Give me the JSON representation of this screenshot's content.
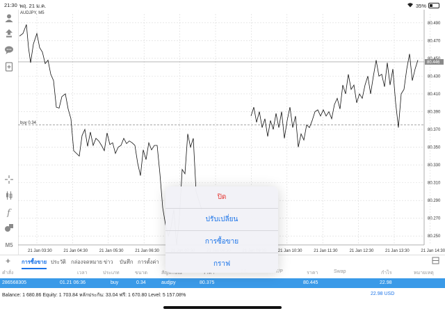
{
  "status": {
    "time": "21:30",
    "date": "พฤ. 21 ม.ค.",
    "battery": "35%"
  },
  "chart": {
    "symbol": "AUDJPY, M5",
    "buy_label": "buy 0.34",
    "price_ticks": [
      "80.490",
      "80.470",
      "80.450",
      "80.430",
      "80.410",
      "80.390",
      "80.370",
      "80.350",
      "80.330",
      "80.310",
      "80.290",
      "80.270",
      "80.250"
    ],
    "price_range": [
      80.24,
      80.5
    ],
    "current_price": "80.446",
    "current_price_value": 80.446,
    "buy_price_value": 80.375,
    "time_ticks": [
      "21 Jan 03:30",
      "21 Jan 04:30",
      "21 Jan 05:30",
      "21 Jan 06:30",
      "21 Jan 07:30",
      "21 Jan 08:30",
      "21 Jan 09:30",
      "21 Jan 10:30",
      "21 Jan 11:30",
      "21 Jan 12:30",
      "21 Jan 13:30",
      "21 Jan 14:30"
    ],
    "line_color": "#111111",
    "grid_color": "#d9d9d9",
    "current_price_color": "#8a8a8a"
  },
  "toolbar": {
    "icons": [
      "person-icon",
      "upload-arrows-icon",
      "chat-icon",
      "add-document-icon",
      "crosshair-icon",
      "candlestick-icon",
      "function-icon",
      "objects-icon",
      "timeframe-icon"
    ],
    "timeframe": "M5"
  },
  "tabs": [
    "การซื้อขาย",
    "ประวัติ",
    "กล่องจดหมาย",
    "ข่าว",
    "บันทึก",
    "การตั้งค่า"
  ],
  "table": {
    "headers": [
      "คำสั่ง",
      "เวลา",
      "ประเภท",
      "ขนาด",
      "สัญลักษณ์",
      "ราคา",
      "S/L",
      "T/P",
      "ราคา",
      "Swap",
      "กำไร",
      "หมายเหตุ"
    ],
    "row": [
      "286568305",
      "01.21 06:36",
      "buy",
      "0.34",
      "audjpy",
      "80.375",
      "",
      "",
      "80.445",
      "",
      "22.98",
      ""
    ]
  },
  "balance": {
    "text": "Balance: 1 680.86 Equity: 1 703.84 หลักประกัน: 33.04 ฟรี: 1 670.80 Level: 5 157.08%",
    "profit": "22.98",
    "currency": "USD"
  },
  "popup": {
    "items": [
      "ปิด",
      "ปรับเปลี่ยน",
      "การซื้อขาย",
      "กราฟ"
    ]
  }
}
